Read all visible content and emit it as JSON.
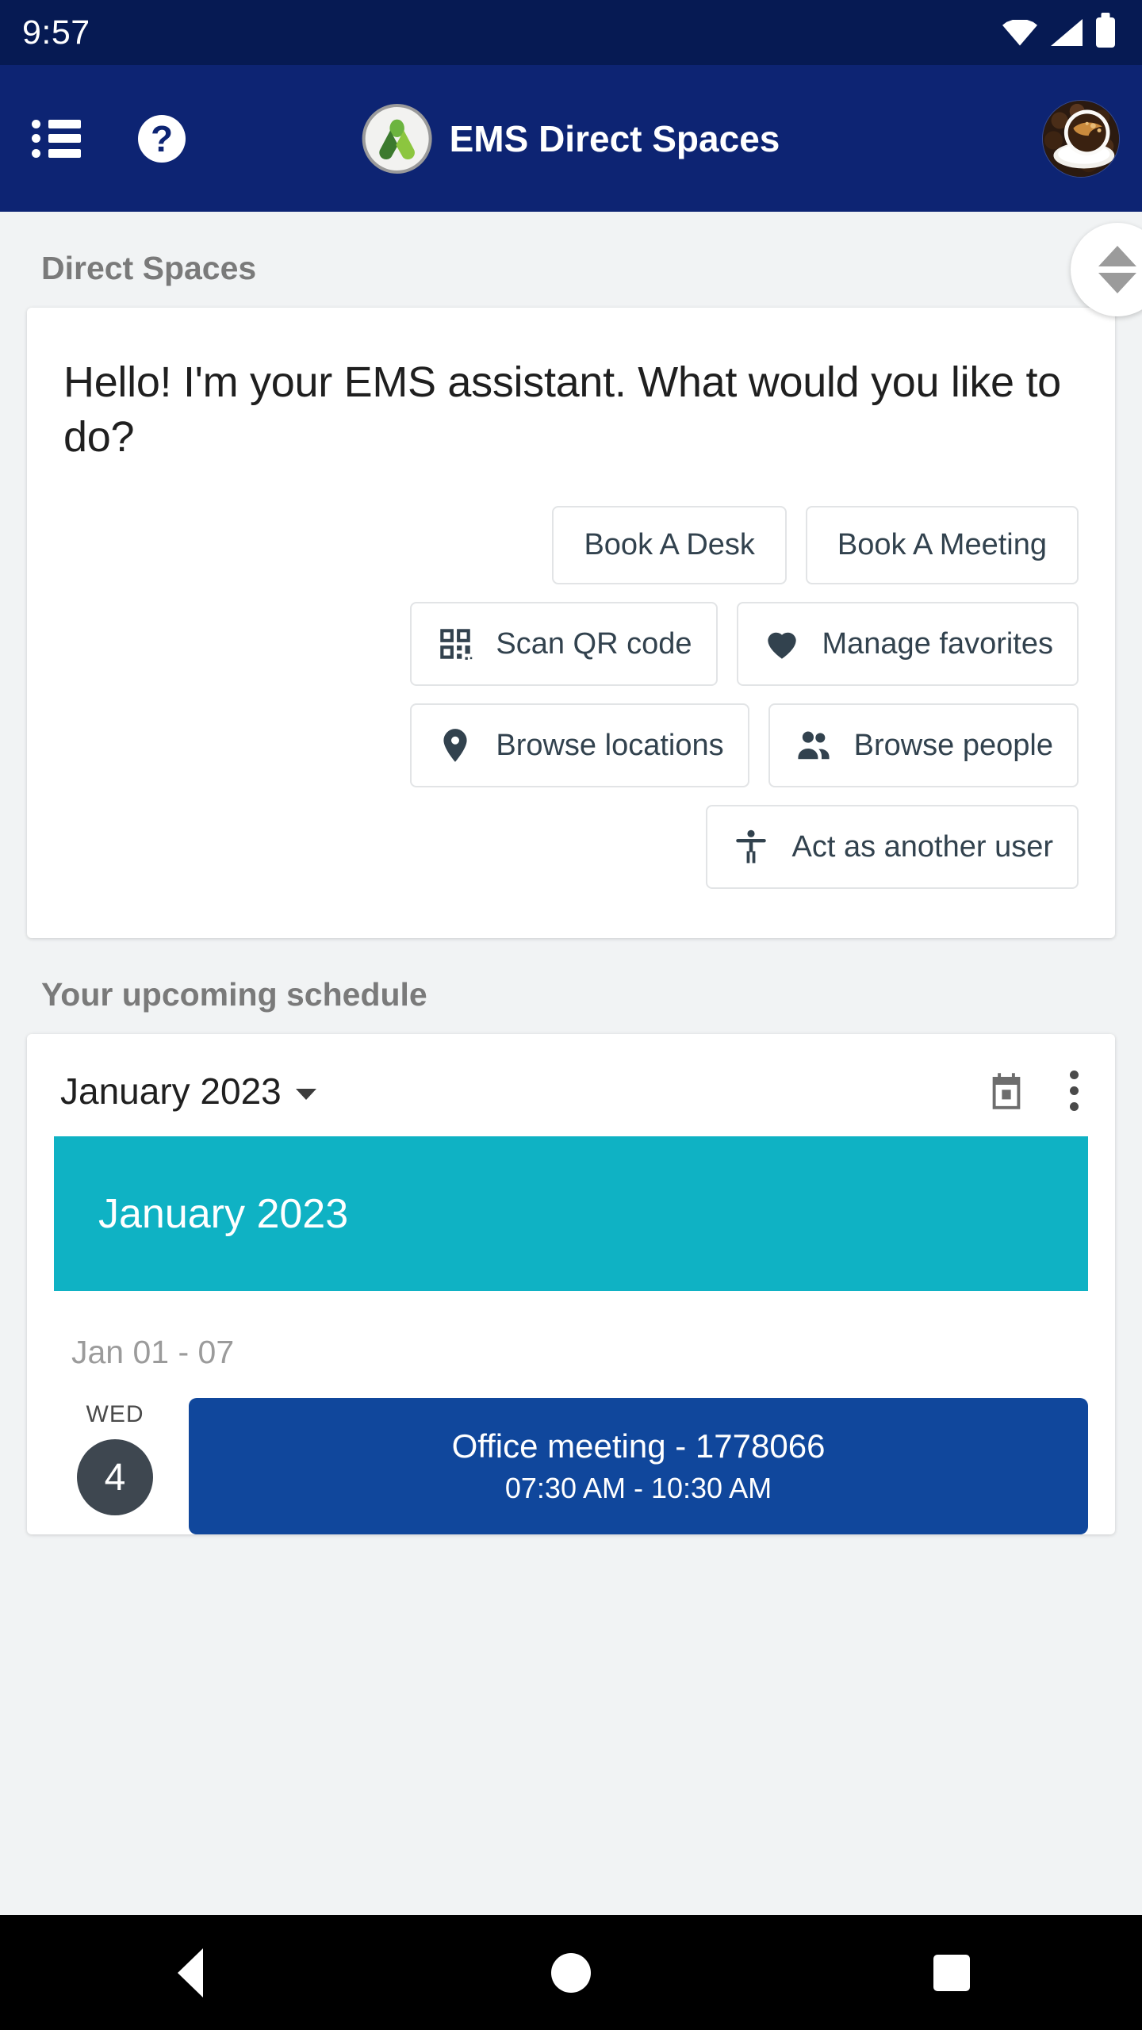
{
  "status_bar": {
    "time": "9:57",
    "icons": [
      "wifi-icon",
      "cellular-signal-icon",
      "battery-full-icon"
    ]
  },
  "app_bar": {
    "menu_icon": "list-menu-icon",
    "help_icon": "help-circle-icon",
    "help_glyph": "?",
    "logo_icon": "ems-leaf-logo-icon",
    "title": "EMS Direct Spaces",
    "avatar_icon": "user-avatar-coffee-image",
    "bg_color": "#0d2473",
    "status_bg_color": "#061a53"
  },
  "page": {
    "section_label": "Direct Spaces"
  },
  "assistant": {
    "greeting": "Hello! I'm your EMS assistant. What would you like to do?",
    "actions": [
      [
        {
          "label": "Book A Desk",
          "icon": null
        },
        {
          "label": "Book A Meeting",
          "icon": null
        }
      ],
      [
        {
          "label": "Scan QR code",
          "icon": "qr-code-icon"
        },
        {
          "label": "Manage favorites",
          "icon": "heart-icon"
        }
      ],
      [
        {
          "label": "Browse locations",
          "icon": "map-pin-icon"
        },
        {
          "label": "Browse people",
          "icon": "people-icon"
        }
      ],
      [
        {
          "label": "Act as another user",
          "icon": "accessibility-person-icon"
        }
      ]
    ]
  },
  "schedule": {
    "section_label": "Your upcoming schedule",
    "month_selector": "January 2023",
    "calendar_icon": "calendar-icon",
    "overflow_icon": "kebab-menu-icon",
    "month_banner": "January 2023",
    "banner_color": "#0fb2c4",
    "week_range": "Jan 01 - 07",
    "events": [
      {
        "day_name": "WED",
        "day_number": "4",
        "title": "Office meeting - 1778066",
        "time": "07:30 AM - 10:30 AM",
        "color": "#10479c"
      }
    ]
  },
  "scroll": {
    "fast_scroll_icon": "scroll-thumb-up-down-icon"
  },
  "nav_bar": {
    "back": "back-triangle-icon",
    "home": "home-circle-icon",
    "recents": "recents-square-icon"
  }
}
